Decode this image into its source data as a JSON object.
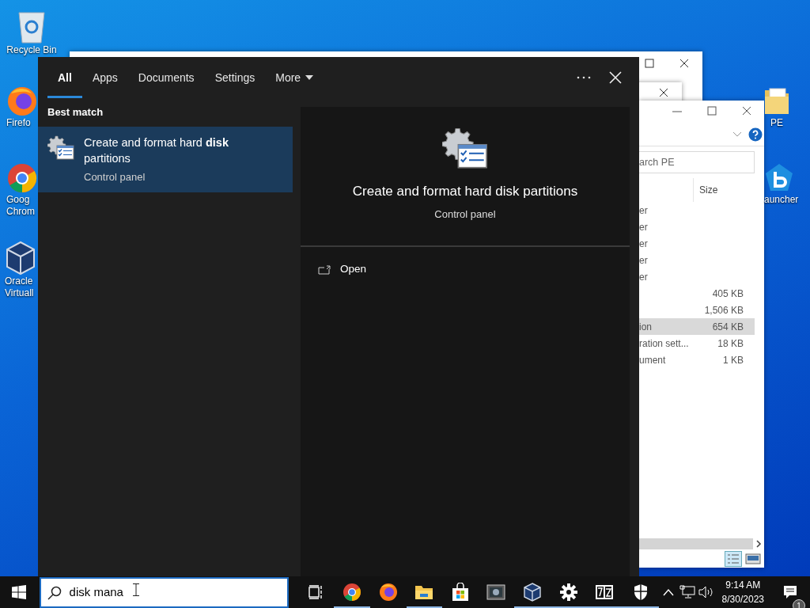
{
  "desktop_icons": [
    {
      "kind": "recycle",
      "lines": [
        "Recycle Bin"
      ]
    },
    {
      "kind": "firefox",
      "lines": [
        "Firefo"
      ]
    },
    {
      "kind": "chrome",
      "lines": [
        "Goog",
        "Chrom"
      ]
    },
    {
      "kind": "vbox",
      "lines": [
        "Oracle",
        "Virtuall"
      ]
    },
    {
      "kind": "folder",
      "lines": [
        "PE"
      ]
    },
    {
      "kind": "launcher",
      "lines": [
        "auncher"
      ]
    }
  ],
  "explorer": {
    "search": {
      "placeholder": "arch PE"
    },
    "columns": [
      "Size"
    ],
    "rows": [
      {
        "name": "er",
        "selected": false
      },
      {
        "name": "er",
        "selected": false
      },
      {
        "name": "er",
        "selected": false
      },
      {
        "name": "er",
        "selected": false
      },
      {
        "name": "er",
        "selected": false
      },
      {
        "size": "405 KB",
        "selected": false
      },
      {
        "size": "1,506 KB",
        "selected": false
      },
      {
        "name": "ion",
        "size": "654 KB",
        "selected": true
      },
      {
        "name": "ration sett...",
        "size": "18 KB",
        "selected": false
      },
      {
        "name": "ument",
        "size": "1 KB",
        "selected": false
      }
    ]
  },
  "search_panel": {
    "tabs": [
      {
        "label": "All",
        "selected": true
      },
      {
        "label": "Apps",
        "selected": false
      },
      {
        "label": "Documents",
        "selected": false
      },
      {
        "label": "Settings",
        "selected": false
      },
      {
        "label": "More",
        "selected": false,
        "kind": "menu"
      }
    ],
    "section": "Best match",
    "result": {
      "title": "Create and format hard **disk** partitions",
      "subtitle": "Control panel",
      "selected": true
    },
    "preview": {
      "title": "Create and format hard disk partitions",
      "subtitle": "Control panel",
      "actions": [
        {
          "label": "Open"
        }
      ]
    }
  },
  "search_box": {
    "value": "disk mana"
  },
  "taskbar": {
    "apps": [
      {
        "kind": "taskview",
        "running": false
      },
      {
        "kind": "chrome",
        "running": true
      },
      {
        "kind": "firefox",
        "running": false
      },
      {
        "kind": "explorer",
        "running": true
      },
      {
        "kind": "store",
        "running": false
      },
      {
        "kind": "monitor",
        "running": false
      },
      {
        "kind": "vbox",
        "running": true
      },
      {
        "kind": "gear",
        "running": true
      },
      {
        "kind": "sevenzip",
        "running": true
      },
      {
        "kind": "shield",
        "running": true
      }
    ],
    "clock": {
      "time": "9:14 AM",
      "date": "8/30/2023"
    },
    "notifications": "1"
  }
}
